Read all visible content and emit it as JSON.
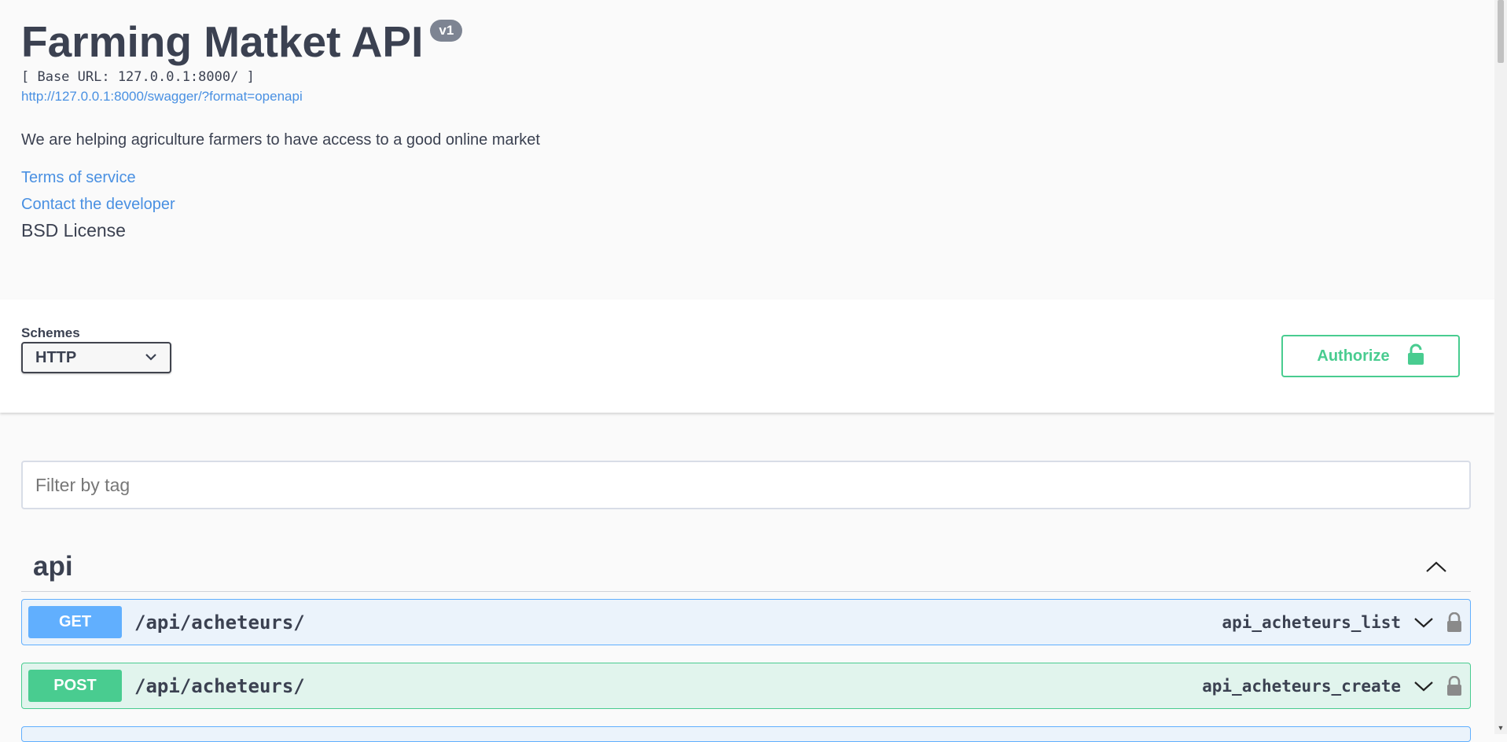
{
  "info": {
    "title": "Farming Matket API",
    "version": "v1",
    "base_url": "[ Base URL: 127.0.0.1:8000/ ]",
    "spec_link": "http://127.0.0.1:8000/swagger/?format=openapi",
    "description": "We are helping agriculture farmers to have access to a good online market",
    "terms_of_service": "Terms of service",
    "contact": "Contact the developer",
    "license": "BSD License"
  },
  "schemes": {
    "label": "Schemes",
    "selected": "HTTP"
  },
  "authorize": {
    "label": "Authorize",
    "icon": "unlock-icon",
    "color": "#49cc90"
  },
  "filter": {
    "placeholder": "Filter by tag"
  },
  "tag": {
    "name": "api",
    "operations": [
      {
        "method": "GET",
        "path": "/api/acheteurs/",
        "operation_id": "api_acheteurs_list",
        "color": "#61affe"
      },
      {
        "method": "POST",
        "path": "/api/acheteurs/",
        "operation_id": "api_acheteurs_create",
        "color": "#49cc90"
      }
    ]
  }
}
